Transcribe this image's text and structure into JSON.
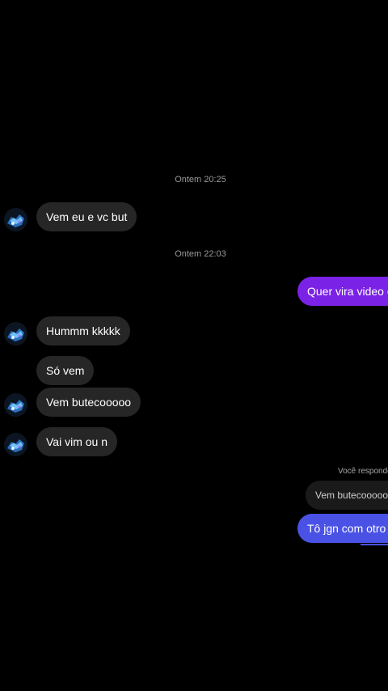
{
  "timestamps": [
    "Ontem 20:25",
    "Ontem 22:03"
  ],
  "incoming": [
    {
      "text": "Vem eu e vc but"
    },
    {
      "text": "Hummm kkkkk"
    },
    {
      "text": "Só vem"
    },
    {
      "text": "Vem butecooooo"
    },
    {
      "text": "Vai vim ou n"
    }
  ],
  "outgoing": [
    {
      "text": "Quer vira video é?"
    },
    {
      "text": "Tô jgn com otro a"
    }
  ],
  "reply": {
    "label": "Você respondeu",
    "quote": "Vem butecooooo"
  },
  "colors": {
    "background": "#000000",
    "incoming_bubble": "#262626",
    "outgoing_purple": "#7a22e6",
    "outgoing_blue": "#4a52e6"
  }
}
